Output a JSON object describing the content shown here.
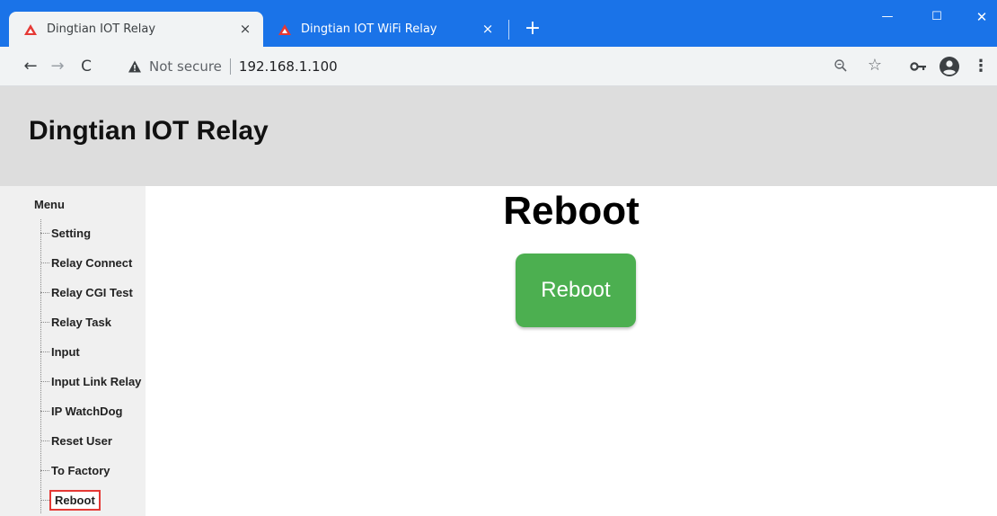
{
  "browser": {
    "tabs": [
      {
        "title": "Dingtian IOT Relay",
        "active": true
      },
      {
        "title": "Dingtian IOT WiFi Relay",
        "active": false
      }
    ],
    "tab_close_glyph": "×",
    "new_tab_glyph": "+",
    "window_controls": {
      "minimize": "—",
      "maximize": "☐",
      "close": "✕"
    },
    "toolbar": {
      "back_glyph": "←",
      "forward_glyph": "→",
      "reload_glyph": "C",
      "security_text": "Not secure",
      "url": "192.168.1.100",
      "star_glyph": "☆",
      "menu_glyph": "⋮"
    },
    "accent_color": "#1a73e8",
    "favicon_color": "#e53935"
  },
  "page": {
    "header_title": "Dingtian IOT Relay",
    "sidebar": {
      "menu_label": "Menu",
      "items": [
        {
          "label": "Setting"
        },
        {
          "label": "Relay Connect"
        },
        {
          "label": "Relay CGI Test"
        },
        {
          "label": "Relay Task"
        },
        {
          "label": "Input"
        },
        {
          "label": "Input Link Relay"
        },
        {
          "label": "IP WatchDog"
        },
        {
          "label": "Reset User"
        },
        {
          "label": "To Factory"
        },
        {
          "label": "Reboot",
          "selected": true
        }
      ],
      "selection_outline_color": "#e53935"
    },
    "main": {
      "heading": "Reboot",
      "reboot_button_label": "Reboot",
      "reboot_button_color": "#4caf50"
    }
  }
}
